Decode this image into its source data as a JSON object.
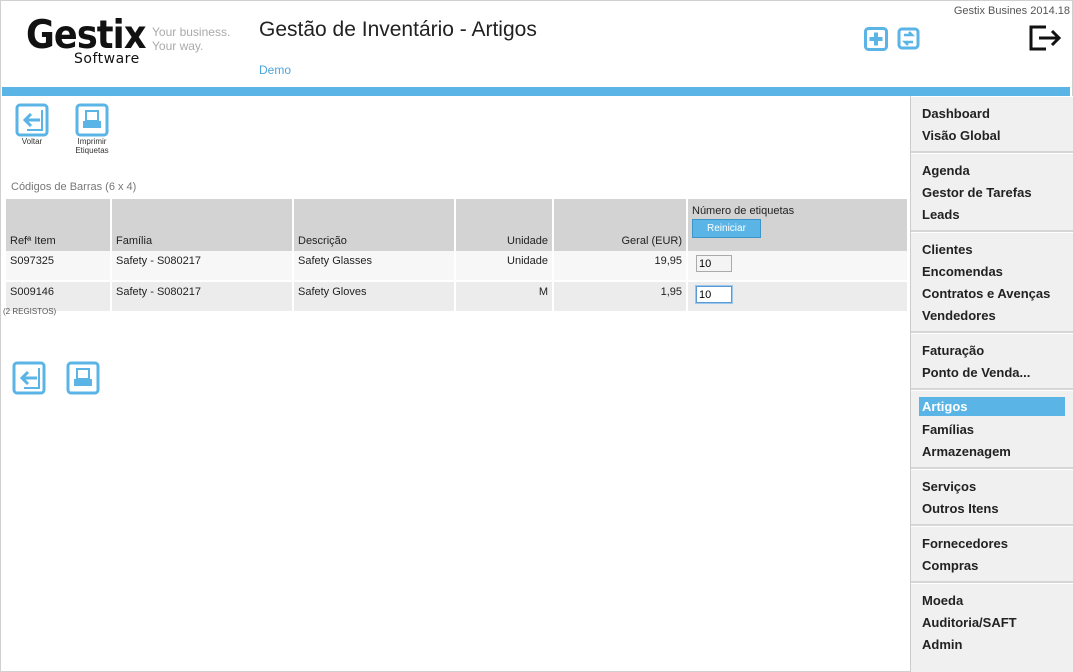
{
  "app": {
    "version": "Gestix Busines 2014.18",
    "logo_main": "Gestix",
    "logo_sub": "Software",
    "tagline_1": "Your business.",
    "tagline_2": "Your way.",
    "title": "Gestão de Inventário - Artigos",
    "company": "Demo"
  },
  "toolbar": {
    "back_label": "Voltar",
    "print_label_1": "Imprimir",
    "print_label_2": "Etiquetas"
  },
  "section": {
    "title": "Códigos de Barras (6 x 4)"
  },
  "table": {
    "headers": {
      "ref": "Refª Item",
      "family": "Família",
      "description": "Descrição",
      "unit": "Unidade",
      "price": "Geral (EUR)",
      "labels": "Número de etiquetas"
    },
    "reset_label": "Reiniciar",
    "rows": [
      {
        "ref": "S097325",
        "family": "Safety - S080217",
        "description": "Safety Glasses",
        "unit": "Unidade",
        "price": "19,95",
        "qty": "10"
      },
      {
        "ref": "S009146",
        "family": "Safety - S080217",
        "description": "Safety Gloves",
        "unit": "M",
        "price": "1,95",
        "qty": "10"
      }
    ],
    "records": "(2 REGISTOS)"
  },
  "sidebar": {
    "groups": [
      [
        "Dashboard",
        "Visão Global"
      ],
      [
        "Agenda",
        "Gestor de Tarefas",
        "Leads"
      ],
      [
        "Clientes",
        "Encomendas",
        "Contratos e Avenças",
        "Vendedores"
      ],
      [
        "Faturação",
        "Ponto de Venda..."
      ],
      [
        "Artigos",
        "Famílias",
        "Armazenagem"
      ],
      [
        "Serviços",
        "Outros Itens"
      ],
      [
        "Fornecedores",
        "Compras"
      ],
      [
        "Moeda",
        "Auditoria/SAFT",
        "Admin"
      ]
    ],
    "active": "Artigos"
  },
  "colors": {
    "accent": "#5bb4e6",
    "header_bg": "#d3d3d3",
    "sidebar_bg": "#f0f0f0"
  }
}
